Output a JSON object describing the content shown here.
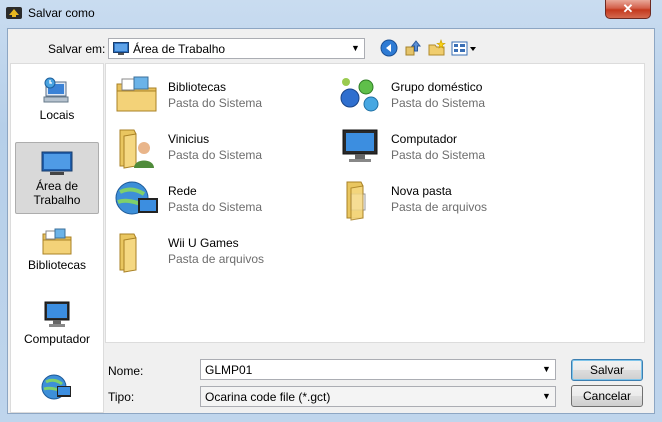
{
  "window": {
    "title": "Salvar como",
    "close_label": "✕"
  },
  "location": {
    "label": "Salvar em:",
    "value": "Área de Trabalho"
  },
  "toolbar": {
    "back": "back-icon",
    "up": "up-folder-icon",
    "new_folder": "new-folder-icon",
    "views": "view-menu-icon"
  },
  "places": [
    {
      "label": "Locais",
      "icon": "recent-places-icon"
    },
    {
      "label": "Área de Trabalho",
      "icon": "desktop-icon",
      "selected": true
    },
    {
      "label": "Bibliotecas",
      "icon": "libraries-icon"
    },
    {
      "label": "Computador",
      "icon": "computer-icon"
    },
    {
      "label": "",
      "icon": "network-icon"
    }
  ],
  "items": [
    {
      "name": "Bibliotecas",
      "type": "Pasta do Sistema",
      "icon": "libraries-icon"
    },
    {
      "name": "Grupo doméstico",
      "type": "Pasta do Sistema",
      "icon": "homegroup-icon"
    },
    {
      "name": "Vinicius",
      "type": "Pasta do Sistema",
      "icon": "user-folder-icon"
    },
    {
      "name": "Computador",
      "type": "Pasta do Sistema",
      "icon": "computer-icon"
    },
    {
      "name": "Rede",
      "type": "Pasta do Sistema",
      "icon": "network-icon"
    },
    {
      "name": "Nova pasta",
      "type": "Pasta de arquivos",
      "icon": "folder-icon"
    },
    {
      "name": "Wii U Games",
      "type": "Pasta de arquivos",
      "icon": "folder-icon"
    }
  ],
  "filename": {
    "label": "Nome:",
    "value": "GLMP01"
  },
  "filetype": {
    "label": "Tipo:",
    "value": "Ocarina code file (*.gct)"
  },
  "buttons": {
    "save": "Salvar",
    "cancel": "Cancelar"
  },
  "colors": {
    "accent": "#3c7fb1",
    "close": "#c4381d",
    "secondary_text": "#6d6d6d"
  }
}
